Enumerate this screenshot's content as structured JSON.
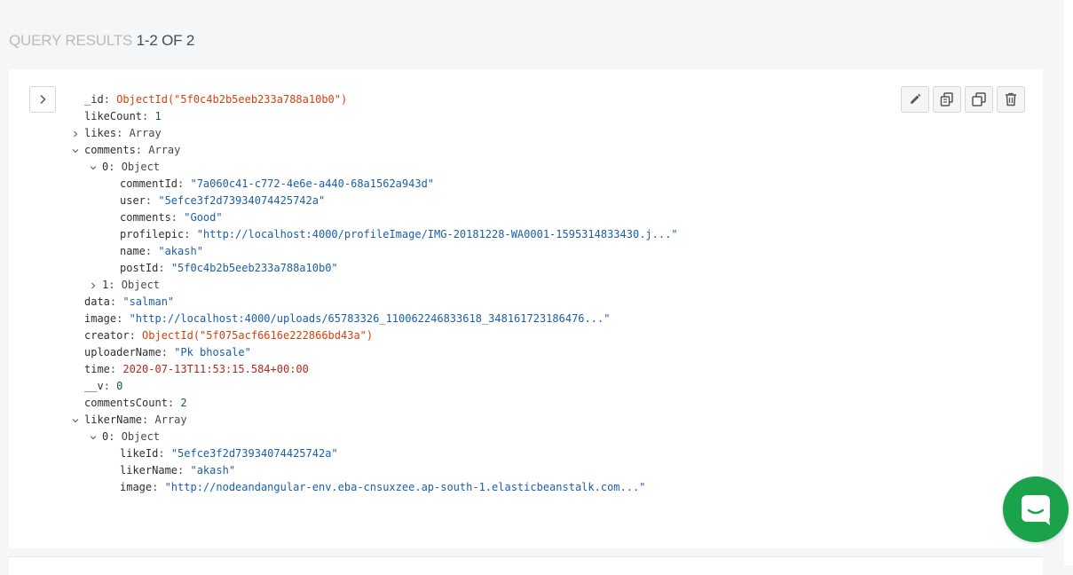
{
  "header": {
    "label": "QUERY RESULTS",
    "count": "1-2 OF 2"
  },
  "document": {
    "id": {
      "key": "_id",
      "value": "ObjectId(\"5f0c4b2b5eeb233a788a10b0\")"
    },
    "likeCount": {
      "key": "likeCount",
      "value": "1"
    },
    "likes": {
      "key": "likes",
      "value": "Array"
    },
    "comments": {
      "key": "comments",
      "value": "Array"
    },
    "c0": {
      "key": "0",
      "value": "Object"
    },
    "commentId": {
      "key": "commentId",
      "value": "\"7a060c41-c772-4e6e-a440-68a1562a943d\""
    },
    "user": {
      "key": "user",
      "value": "\"5efce3f2d73934074425742a\""
    },
    "commentText": {
      "key": "comments",
      "value": "\"Good\""
    },
    "profilepic": {
      "key": "profilepic",
      "value": "\"http://localhost:4000/profileImage/IMG-20181228-WA0001-1595314833430.j...\""
    },
    "name": {
      "key": "name",
      "value": "\"akash\""
    },
    "postId": {
      "key": "postId",
      "value": "\"5f0c4b2b5eeb233a788a10b0\""
    },
    "c1": {
      "key": "1",
      "value": "Object"
    },
    "data": {
      "key": "data",
      "value": "\"salman\""
    },
    "image": {
      "key": "image",
      "value": "\"http://localhost:4000/uploads/65783326_110062246833618_348161723186476...\""
    },
    "creator": {
      "key": "creator",
      "value": "ObjectId(\"5f075acf6616e222866bd43a\")"
    },
    "uploaderName": {
      "key": "uploaderName",
      "value": "\"Pk bhosale\""
    },
    "time": {
      "key": "time",
      "value": "2020-07-13T11:53:15.584+00:00"
    },
    "v": {
      "key": "__v",
      "value": "0"
    },
    "commentsCount": {
      "key": "commentsCount",
      "value": "2"
    },
    "likerName": {
      "key": "likerName",
      "value": "Array"
    },
    "l0": {
      "key": "0",
      "value": "Object"
    },
    "likeId": {
      "key": "likeId",
      "value": "\"5efce3f2d73934074425742a\""
    },
    "likerNameVal": {
      "key": "likerName",
      "value": "\"akash\""
    },
    "likerImage": {
      "key": "image",
      "value": "\"http://nodeandangular-env.eba-cnsuxzee.ap-south-1.elasticbeanstalk.com...\""
    }
  },
  "actions": [
    "edit-icon",
    "clone-icon",
    "copy-icon",
    "delete-icon"
  ],
  "colors": {
    "objectId": "#d93f0b",
    "string": "#1a5fa8",
    "number": "#145a32",
    "date": "#b5271d",
    "chat": "#1aa34a"
  }
}
